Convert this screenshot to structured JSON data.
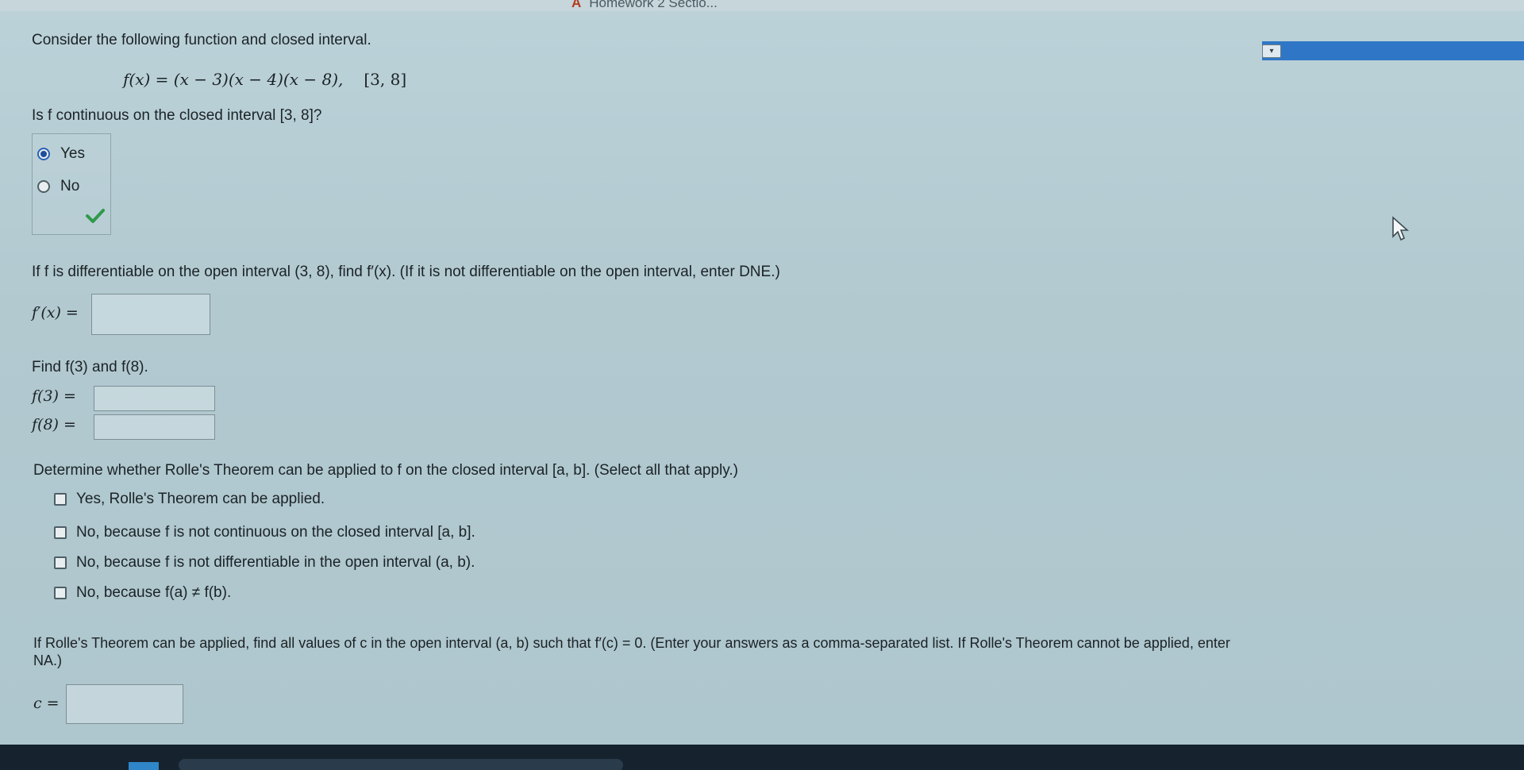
{
  "browser": {
    "tab_title": "Homework 2 Sectio..."
  },
  "intro": "Consider the following function and closed interval.",
  "function_expr": "f(x) = (x − 3)(x − 4)(x − 8),",
  "interval": "[3, 8]",
  "q1": {
    "prompt": "Is f continuous on the closed interval [3, 8]?",
    "options": [
      "Yes",
      "No"
    ],
    "selected": "Yes"
  },
  "q2": {
    "prompt": "If f is differentiable on the open interval (3, 8), find f′(x). (If it is not differentiable on the open interval, enter DNE.)",
    "label": "f′(x) =",
    "value": ""
  },
  "q3": {
    "prompt": "Find f(3) and f(8).",
    "label_a": "f(3) =",
    "label_b": "f(8) =",
    "value_a": "",
    "value_b": ""
  },
  "q4": {
    "prompt": "Determine whether Rolle's Theorem can be applied to f on the closed interval [a, b]. (Select all that apply.)",
    "options": [
      "Yes, Rolle's Theorem can be applied.",
      "No, because f is not continuous on the closed interval [a, b].",
      "No, because f is not differentiable in the open interval (a, b).",
      "No, because f(a) ≠ f(b)."
    ]
  },
  "q5": {
    "prompt_line1": "If Rolle's Theorem can be applied, find all values of c in the open interval (a, b) such that f′(c) = 0. (Enter your answers as a comma-separated list. If Rolle's Theorem cannot be applied, enter",
    "prompt_line2": "NA.)",
    "label": "c =",
    "value": ""
  },
  "colors": {
    "accent": "#2f77c6",
    "correct": "#2e9a4a"
  }
}
